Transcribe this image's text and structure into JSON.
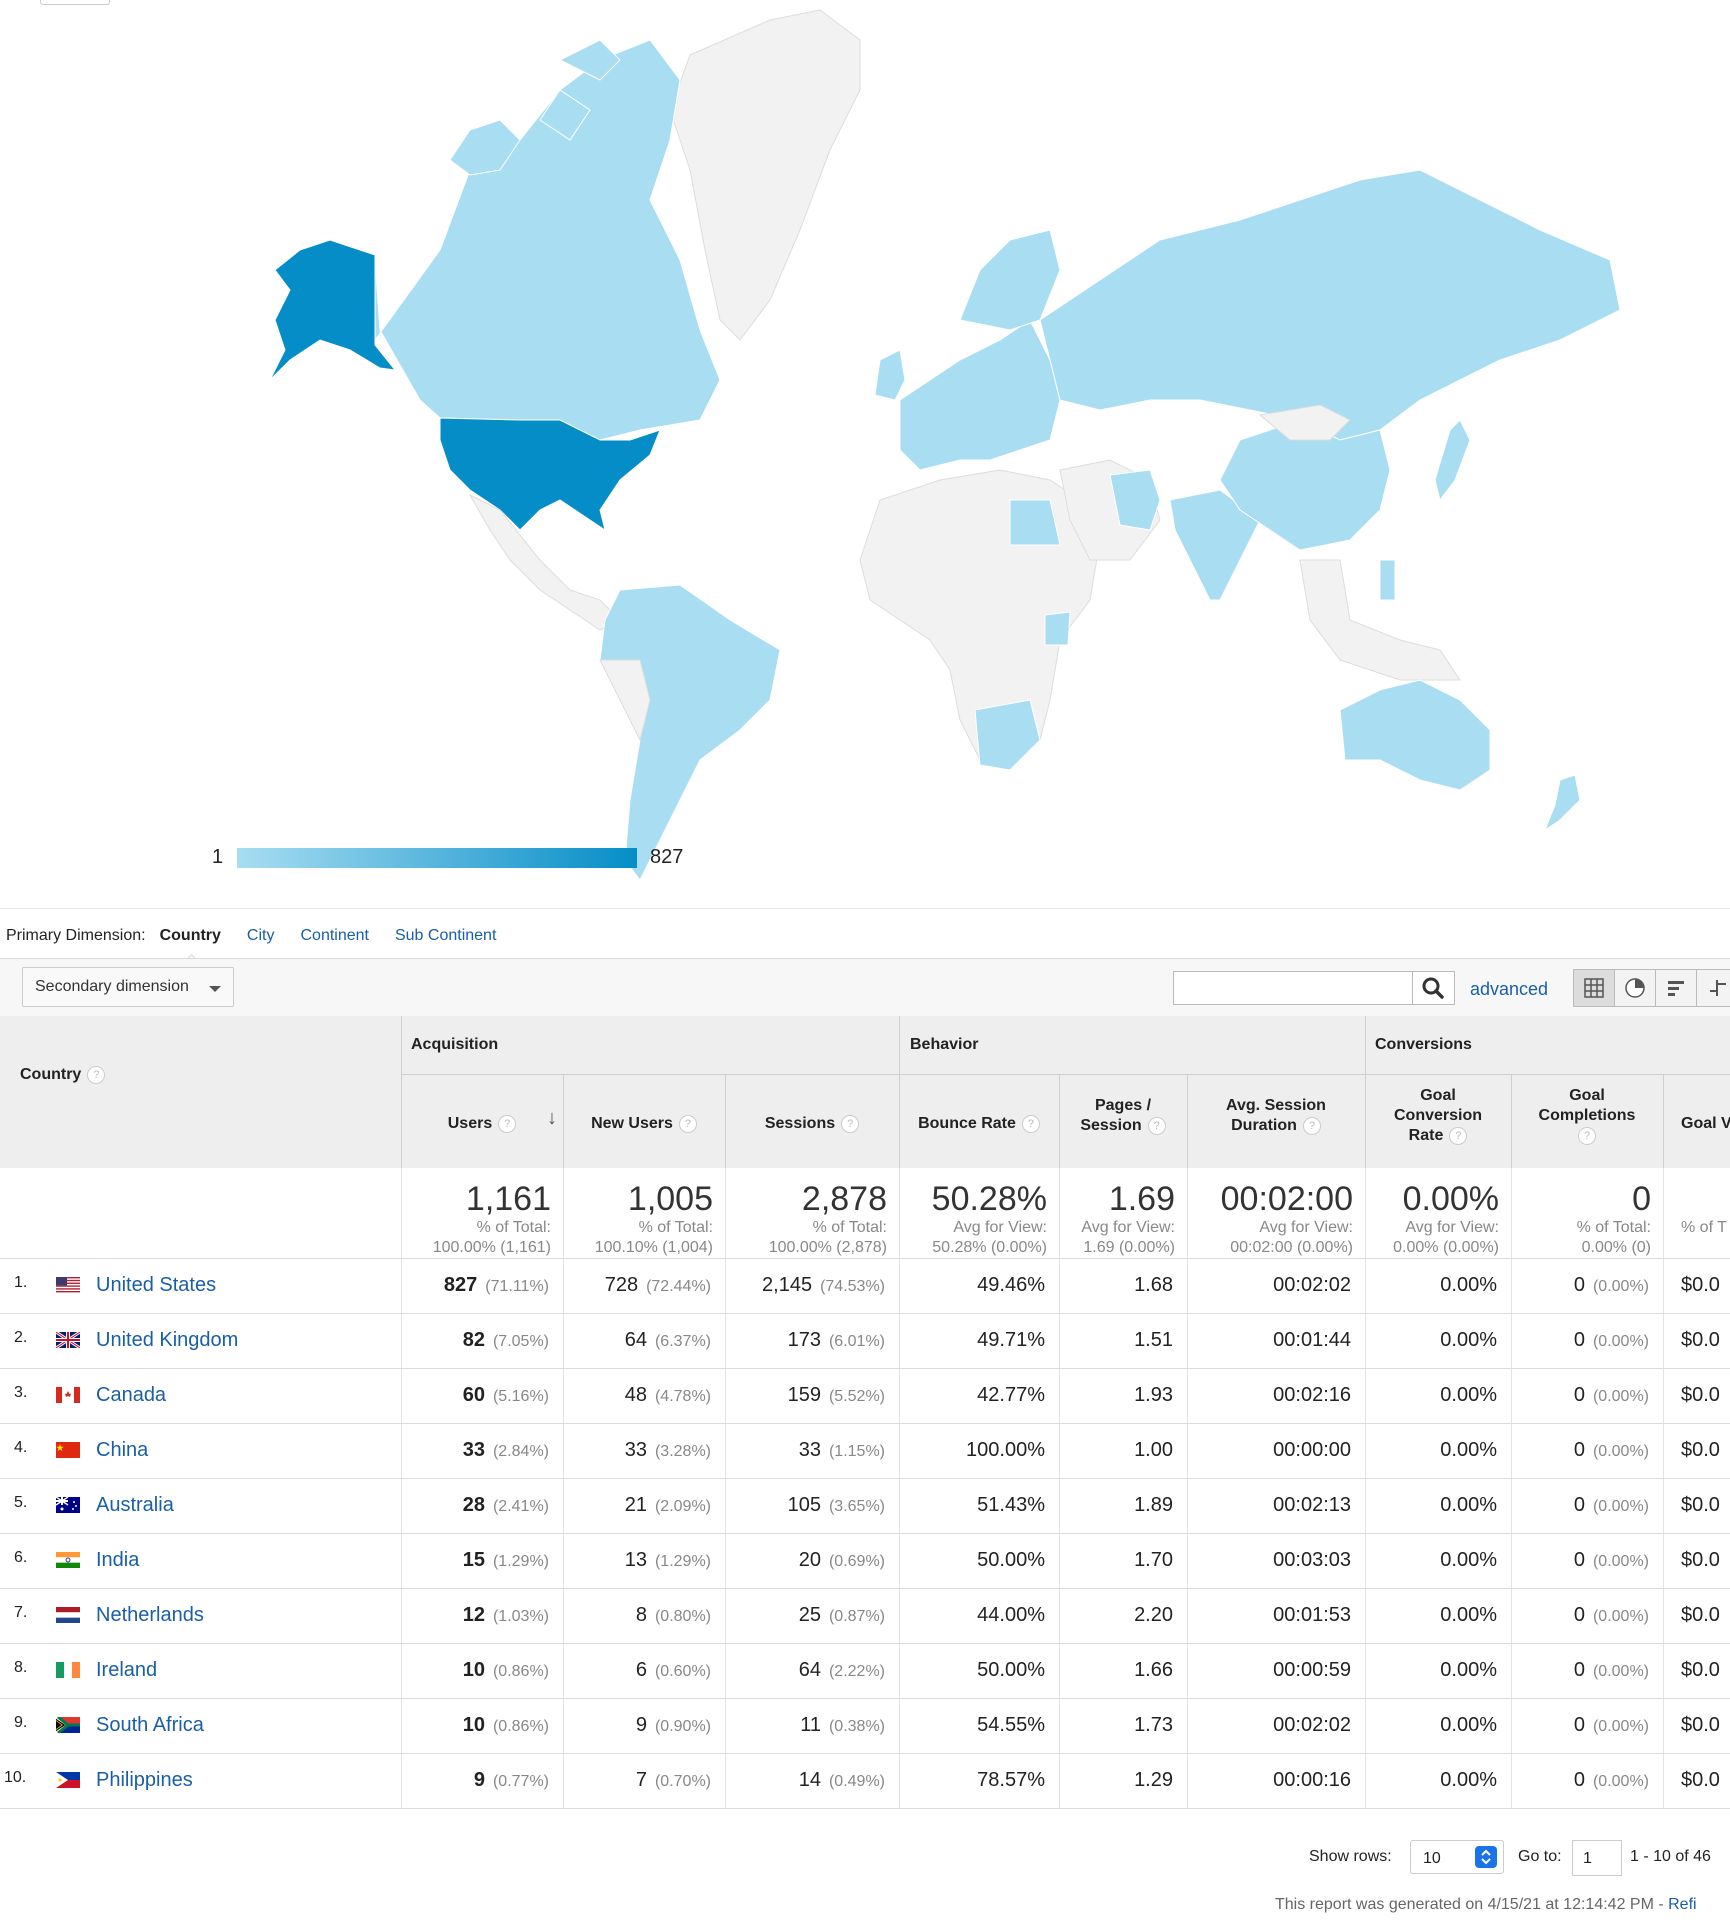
{
  "map": {
    "legend_min": "1",
    "legend_max": "827",
    "color_low": "#a8ddf2",
    "color_high": "#058dc7",
    "color_none": "#f2f2f2"
  },
  "primary_dimension": {
    "label": "Primary Dimension:",
    "current": "Country",
    "options": [
      "City",
      "Continent",
      "Sub Continent"
    ]
  },
  "toolbar": {
    "secondary_dimension": "Secondary dimension",
    "search_value": "",
    "advanced": "advanced"
  },
  "table": {
    "country_header": "Country",
    "groups": {
      "acquisition": "Acquisition",
      "behavior": "Behavior",
      "conversions": "Conversions"
    },
    "columns": {
      "users": "Users",
      "new_users": "New Users",
      "sessions": "Sessions",
      "bounce_rate": "Bounce Rate",
      "pages_session_1": "Pages /",
      "pages_session_2": "Session",
      "avg_duration_1": "Avg. Session",
      "avg_duration_2": "Duration",
      "goal_conv_1": "Goal",
      "goal_conv_2": "Conversion",
      "goal_conv_3": "Rate",
      "goal_comp_1": "Goal",
      "goal_comp_2": "Completions",
      "goal_value": "Goal V"
    },
    "totals": {
      "users": "1,161",
      "users_l1": "% of Total:",
      "users_l2": "100.00% (1,161)",
      "new_users": "1,005",
      "new_users_l1": "% of Total:",
      "new_users_l2": "100.10% (1,004)",
      "sessions": "2,878",
      "sessions_l1": "% of Total:",
      "sessions_l2": "100.00% (2,878)",
      "bounce": "50.28%",
      "bounce_l1": "Avg for View:",
      "bounce_l2": "50.28% (0.00%)",
      "pages": "1.69",
      "pages_l1": "Avg for View:",
      "pages_l2": "1.69 (0.00%)",
      "duration": "00:02:00",
      "duration_l1": "Avg for View:",
      "duration_l2": "00:02:00 (0.00%)",
      "gcr": "0.00%",
      "gcr_l1": "Avg for View:",
      "gcr_l2": "0.00% (0.00%)",
      "gc": "0",
      "gc_l1": "% of Total:",
      "gc_l2": "0.00% (0)",
      "gv_l1": "% of T"
    },
    "rows": [
      {
        "idx": "1.",
        "country": "United States",
        "users": "827",
        "users_pct": "(71.11%)",
        "new": "728",
        "new_pct": "(72.44%)",
        "sess": "2,145",
        "sess_pct": "(74.53%)",
        "bounce": "49.46%",
        "pages": "1.68",
        "dur": "00:02:02",
        "gcr": "0.00%",
        "gc": "0",
        "gc_pct": "(0.00%)",
        "gv": "$0.0"
      },
      {
        "idx": "2.",
        "country": "United Kingdom",
        "users": "82",
        "users_pct": "(7.05%)",
        "new": "64",
        "new_pct": "(6.37%)",
        "sess": "173",
        "sess_pct": "(6.01%)",
        "bounce": "49.71%",
        "pages": "1.51",
        "dur": "00:01:44",
        "gcr": "0.00%",
        "gc": "0",
        "gc_pct": "(0.00%)",
        "gv": "$0.0"
      },
      {
        "idx": "3.",
        "country": "Canada",
        "users": "60",
        "users_pct": "(5.16%)",
        "new": "48",
        "new_pct": "(4.78%)",
        "sess": "159",
        "sess_pct": "(5.52%)",
        "bounce": "42.77%",
        "pages": "1.93",
        "dur": "00:02:16",
        "gcr": "0.00%",
        "gc": "0",
        "gc_pct": "(0.00%)",
        "gv": "$0.0"
      },
      {
        "idx": "4.",
        "country": "China",
        "users": "33",
        "users_pct": "(2.84%)",
        "new": "33",
        "new_pct": "(3.28%)",
        "sess": "33",
        "sess_pct": "(1.15%)",
        "bounce": "100.00%",
        "pages": "1.00",
        "dur": "00:00:00",
        "gcr": "0.00%",
        "gc": "0",
        "gc_pct": "(0.00%)",
        "gv": "$0.0"
      },
      {
        "idx": "5.",
        "country": "Australia",
        "users": "28",
        "users_pct": "(2.41%)",
        "new": "21",
        "new_pct": "(2.09%)",
        "sess": "105",
        "sess_pct": "(3.65%)",
        "bounce": "51.43%",
        "pages": "1.89",
        "dur": "00:02:13",
        "gcr": "0.00%",
        "gc": "0",
        "gc_pct": "(0.00%)",
        "gv": "$0.0"
      },
      {
        "idx": "6.",
        "country": "India",
        "users": "15",
        "users_pct": "(1.29%)",
        "new": "13",
        "new_pct": "(1.29%)",
        "sess": "20",
        "sess_pct": "(0.69%)",
        "bounce": "50.00%",
        "pages": "1.70",
        "dur": "00:03:03",
        "gcr": "0.00%",
        "gc": "0",
        "gc_pct": "(0.00%)",
        "gv": "$0.0"
      },
      {
        "idx": "7.",
        "country": "Netherlands",
        "users": "12",
        "users_pct": "(1.03%)",
        "new": "8",
        "new_pct": "(0.80%)",
        "sess": "25",
        "sess_pct": "(0.87%)",
        "bounce": "44.00%",
        "pages": "2.20",
        "dur": "00:01:53",
        "gcr": "0.00%",
        "gc": "0",
        "gc_pct": "(0.00%)",
        "gv": "$0.0"
      },
      {
        "idx": "8.",
        "country": "Ireland",
        "users": "10",
        "users_pct": "(0.86%)",
        "new": "6",
        "new_pct": "(0.60%)",
        "sess": "64",
        "sess_pct": "(2.22%)",
        "bounce": "50.00%",
        "pages": "1.66",
        "dur": "00:00:59",
        "gcr": "0.00%",
        "gc": "0",
        "gc_pct": "(0.00%)",
        "gv": "$0.0"
      },
      {
        "idx": "9.",
        "country": "South Africa",
        "users": "10",
        "users_pct": "(0.86%)",
        "new": "9",
        "new_pct": "(0.90%)",
        "sess": "11",
        "sess_pct": "(0.38%)",
        "bounce": "54.55%",
        "pages": "1.73",
        "dur": "00:02:02",
        "gcr": "0.00%",
        "gc": "0",
        "gc_pct": "(0.00%)",
        "gv": "$0.0"
      },
      {
        "idx": "10.",
        "country": "Philippines",
        "users": "9",
        "users_pct": "(0.77%)",
        "new": "7",
        "new_pct": "(0.70%)",
        "sess": "14",
        "sess_pct": "(0.49%)",
        "bounce": "78.57%",
        "pages": "1.29",
        "dur": "00:00:16",
        "gcr": "0.00%",
        "gc": "0",
        "gc_pct": "(0.00%)",
        "gv": "$0.0"
      }
    ]
  },
  "footer": {
    "show_rows": "Show rows:",
    "rows_value": "10",
    "go_to": "Go to:",
    "go_to_value": "1",
    "range": "1 - 10 of 46",
    "generated": "This report was generated on 4/15/21 at 12:14:42 PM - ",
    "refresh": "Refi"
  }
}
